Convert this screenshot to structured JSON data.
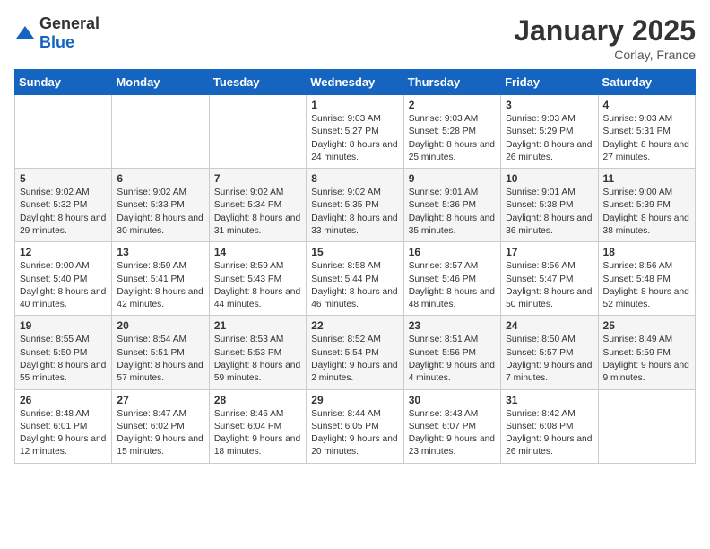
{
  "header": {
    "logo_general": "General",
    "logo_blue": "Blue",
    "month": "January 2025",
    "location": "Corlay, France"
  },
  "days_of_week": [
    "Sunday",
    "Monday",
    "Tuesday",
    "Wednesday",
    "Thursday",
    "Friday",
    "Saturday"
  ],
  "weeks": [
    [
      {
        "day": "",
        "content": ""
      },
      {
        "day": "",
        "content": ""
      },
      {
        "day": "",
        "content": ""
      },
      {
        "day": "1",
        "content": "Sunrise: 9:03 AM\nSunset: 5:27 PM\nDaylight: 8 hours and 24 minutes."
      },
      {
        "day": "2",
        "content": "Sunrise: 9:03 AM\nSunset: 5:28 PM\nDaylight: 8 hours and 25 minutes."
      },
      {
        "day": "3",
        "content": "Sunrise: 9:03 AM\nSunset: 5:29 PM\nDaylight: 8 hours and 26 minutes."
      },
      {
        "day": "4",
        "content": "Sunrise: 9:03 AM\nSunset: 5:31 PM\nDaylight: 8 hours and 27 minutes."
      }
    ],
    [
      {
        "day": "5",
        "content": "Sunrise: 9:02 AM\nSunset: 5:32 PM\nDaylight: 8 hours and 29 minutes."
      },
      {
        "day": "6",
        "content": "Sunrise: 9:02 AM\nSunset: 5:33 PM\nDaylight: 8 hours and 30 minutes."
      },
      {
        "day": "7",
        "content": "Sunrise: 9:02 AM\nSunset: 5:34 PM\nDaylight: 8 hours and 31 minutes."
      },
      {
        "day": "8",
        "content": "Sunrise: 9:02 AM\nSunset: 5:35 PM\nDaylight: 8 hours and 33 minutes."
      },
      {
        "day": "9",
        "content": "Sunrise: 9:01 AM\nSunset: 5:36 PM\nDaylight: 8 hours and 35 minutes."
      },
      {
        "day": "10",
        "content": "Sunrise: 9:01 AM\nSunset: 5:38 PM\nDaylight: 8 hours and 36 minutes."
      },
      {
        "day": "11",
        "content": "Sunrise: 9:00 AM\nSunset: 5:39 PM\nDaylight: 8 hours and 38 minutes."
      }
    ],
    [
      {
        "day": "12",
        "content": "Sunrise: 9:00 AM\nSunset: 5:40 PM\nDaylight: 8 hours and 40 minutes."
      },
      {
        "day": "13",
        "content": "Sunrise: 8:59 AM\nSunset: 5:41 PM\nDaylight: 8 hours and 42 minutes."
      },
      {
        "day": "14",
        "content": "Sunrise: 8:59 AM\nSunset: 5:43 PM\nDaylight: 8 hours and 44 minutes."
      },
      {
        "day": "15",
        "content": "Sunrise: 8:58 AM\nSunset: 5:44 PM\nDaylight: 8 hours and 46 minutes."
      },
      {
        "day": "16",
        "content": "Sunrise: 8:57 AM\nSunset: 5:46 PM\nDaylight: 8 hours and 48 minutes."
      },
      {
        "day": "17",
        "content": "Sunrise: 8:56 AM\nSunset: 5:47 PM\nDaylight: 8 hours and 50 minutes."
      },
      {
        "day": "18",
        "content": "Sunrise: 8:56 AM\nSunset: 5:48 PM\nDaylight: 8 hours and 52 minutes."
      }
    ],
    [
      {
        "day": "19",
        "content": "Sunrise: 8:55 AM\nSunset: 5:50 PM\nDaylight: 8 hours and 55 minutes."
      },
      {
        "day": "20",
        "content": "Sunrise: 8:54 AM\nSunset: 5:51 PM\nDaylight: 8 hours and 57 minutes."
      },
      {
        "day": "21",
        "content": "Sunrise: 8:53 AM\nSunset: 5:53 PM\nDaylight: 8 hours and 59 minutes."
      },
      {
        "day": "22",
        "content": "Sunrise: 8:52 AM\nSunset: 5:54 PM\nDaylight: 9 hours and 2 minutes."
      },
      {
        "day": "23",
        "content": "Sunrise: 8:51 AM\nSunset: 5:56 PM\nDaylight: 9 hours and 4 minutes."
      },
      {
        "day": "24",
        "content": "Sunrise: 8:50 AM\nSunset: 5:57 PM\nDaylight: 9 hours and 7 minutes."
      },
      {
        "day": "25",
        "content": "Sunrise: 8:49 AM\nSunset: 5:59 PM\nDaylight: 9 hours and 9 minutes."
      }
    ],
    [
      {
        "day": "26",
        "content": "Sunrise: 8:48 AM\nSunset: 6:01 PM\nDaylight: 9 hours and 12 minutes."
      },
      {
        "day": "27",
        "content": "Sunrise: 8:47 AM\nSunset: 6:02 PM\nDaylight: 9 hours and 15 minutes."
      },
      {
        "day": "28",
        "content": "Sunrise: 8:46 AM\nSunset: 6:04 PM\nDaylight: 9 hours and 18 minutes."
      },
      {
        "day": "29",
        "content": "Sunrise: 8:44 AM\nSunset: 6:05 PM\nDaylight: 9 hours and 20 minutes."
      },
      {
        "day": "30",
        "content": "Sunrise: 8:43 AM\nSunset: 6:07 PM\nDaylight: 9 hours and 23 minutes."
      },
      {
        "day": "31",
        "content": "Sunrise: 8:42 AM\nSunset: 6:08 PM\nDaylight: 9 hours and 26 minutes."
      },
      {
        "day": "",
        "content": ""
      }
    ]
  ]
}
